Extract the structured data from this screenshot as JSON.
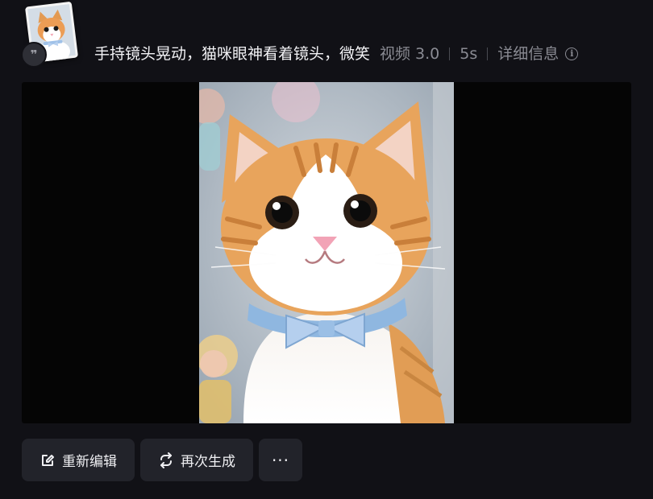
{
  "header": {
    "prompt": "手持镜头晃动，猫咪眼神看着镜头，微笑",
    "model": "视频 3.0",
    "duration": "5s",
    "detail_label": "详细信息",
    "quote_glyph": "❞",
    "info_glyph": "i"
  },
  "player": {
    "frame_background": "#b8c4cf",
    "cat_fur_color": "#e8a45c",
    "bow_color": "#a9c8ea"
  },
  "actions": {
    "edit_label": "重新编辑",
    "regenerate_label": "再次生成",
    "more_label": "···"
  },
  "icons": {
    "edit": "edit-icon",
    "regenerate": "refresh-icon",
    "more": "more-icon",
    "info": "info-icon",
    "quote": "quote-icon"
  }
}
